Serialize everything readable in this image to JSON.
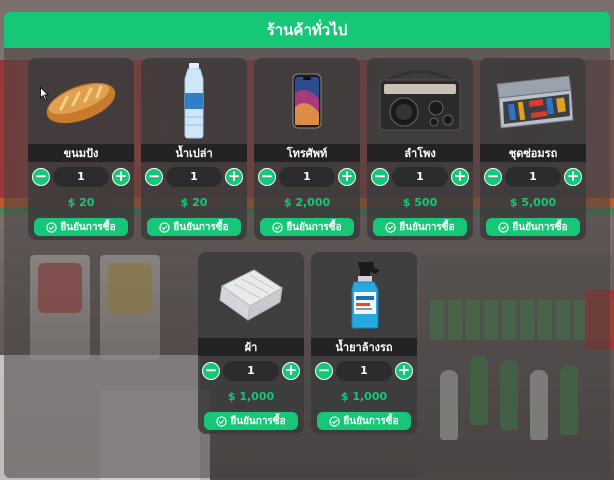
{
  "shop": {
    "title": "ร้านค้าทั่วไป",
    "confirm_label": "ยืนยันการซื้อ",
    "currency_symbol": "$",
    "accent_color": "#16c777"
  },
  "items": [
    {
      "name": "ขนมปัง",
      "qty": "1",
      "price": "20",
      "icon": "bread-icon"
    },
    {
      "name": "น้ำเปล่า",
      "qty": "1",
      "price": "20",
      "icon": "water-bottle-icon"
    },
    {
      "name": "โทรศัพท์",
      "qty": "1",
      "price": "2,000",
      "icon": "phone-icon"
    },
    {
      "name": "ลำโพง",
      "qty": "1",
      "price": "500",
      "icon": "radio-speaker-icon"
    },
    {
      "name": "ชุดซ่อมรถ",
      "qty": "1",
      "price": "5,000",
      "icon": "repair-kit-icon"
    },
    {
      "name": "ผ้า",
      "qty": "1",
      "price": "1,000",
      "icon": "cloth-icon"
    },
    {
      "name": "น้ำยาล้างรถ",
      "qty": "1",
      "price": "1,000",
      "icon": "car-wash-spray-icon"
    }
  ]
}
